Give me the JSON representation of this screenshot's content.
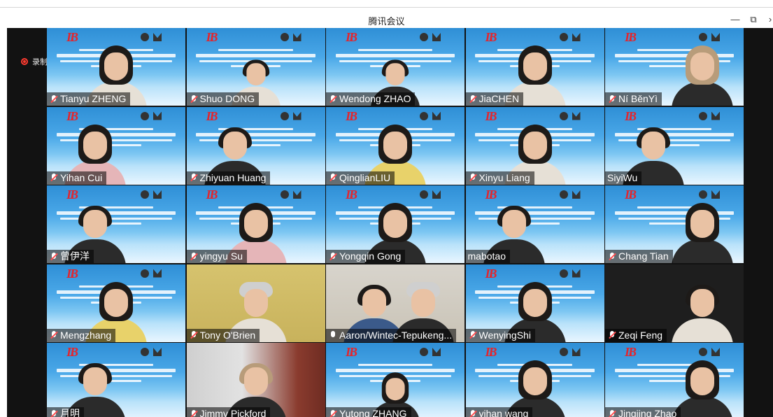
{
  "window": {
    "title": "腾讯会议",
    "minimize": "—",
    "maximize": "⧉",
    "more": "›"
  },
  "recording": {
    "label": "录制中"
  },
  "participants": [
    {
      "name": "Tianyu ZHENG",
      "mic": "muted"
    },
    {
      "name": "Shuo DONG",
      "mic": "muted"
    },
    {
      "name": "Wendong ZHAO",
      "mic": "muted"
    },
    {
      "name": "JiaCHEN",
      "mic": "muted"
    },
    {
      "name": "Ní BěnYì",
      "mic": "muted"
    },
    {
      "name": "Yihan Cui",
      "mic": "muted"
    },
    {
      "name": "Zhiyuan Huang",
      "mic": "muted"
    },
    {
      "name": "QinglianLIU",
      "mic": "muted"
    },
    {
      "name": "Xinyu Liang",
      "mic": "muted"
    },
    {
      "name": "SiyiWu",
      "mic": "none"
    },
    {
      "name": "曾伊洋",
      "mic": "muted"
    },
    {
      "name": "yingyu Su",
      "mic": "muted"
    },
    {
      "name": "Yongqin Gong",
      "mic": "muted"
    },
    {
      "name": "mabotao",
      "mic": "none"
    },
    {
      "name": "Chang Tian",
      "mic": "muted"
    },
    {
      "name": "Mengzhang",
      "mic": "muted"
    },
    {
      "name": "Tony O'Brien",
      "mic": "muted"
    },
    {
      "name": "Aaron/Wintec-Tepukeng...",
      "mic": "on"
    },
    {
      "name": "WenyingShi",
      "mic": "muted"
    },
    {
      "name": "Zeqi Feng",
      "mic": "muted"
    },
    {
      "name": "月明",
      "mic": "muted"
    },
    {
      "name": "Jimmy Pickford",
      "mic": "muted"
    },
    {
      "name": "Yutong ZHANG",
      "mic": "muted"
    },
    {
      "name": "yihan wang",
      "mic": "muted"
    },
    {
      "name": "Jingjing Zhao",
      "mic": "muted"
    }
  ]
}
